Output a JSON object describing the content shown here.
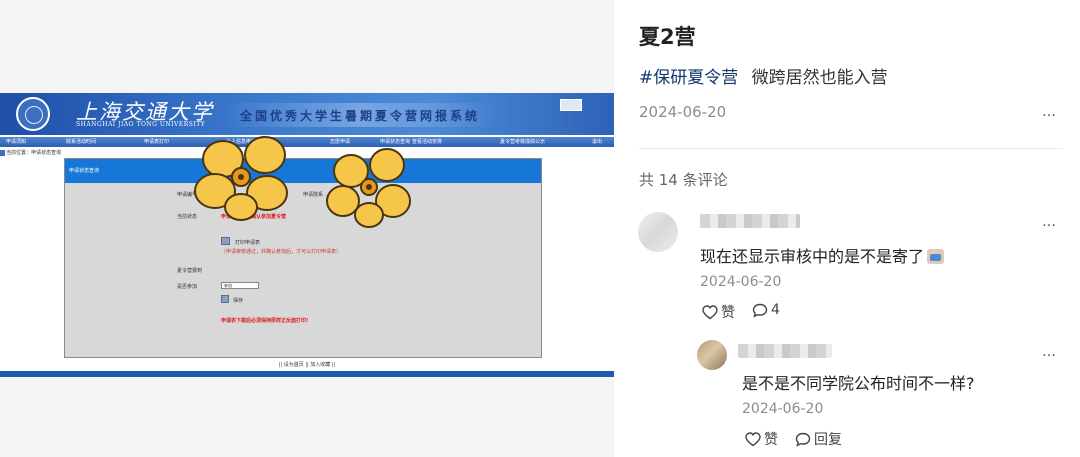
{
  "screenshot": {
    "university_name_cn": "上海交通大学",
    "university_name_en": "SHANGHAI JIAO TONG UNIVERSITY",
    "system_title": "全国优秀大学生暑期夏令营网报系统",
    "nav_items": [
      "申请须知",
      "院系活动时间",
      "申请表打印",
      "个人信息维护",
      "志愿申请",
      "申请状态查询",
      "查看活动安排",
      "夏令营考核成绩公示",
      "退出"
    ],
    "breadcrumb": "当前位置：申请状态查询",
    "status_panel_title": "申请状态查询",
    "apply_label": "申请编号",
    "apply_label_2": "申请院系",
    "status_label": "当前状态",
    "status_value": "申请通过，请确认参加夏令营",
    "print_link": "打印申请表",
    "print_note": "（申请审核通过，并确认参加后，才可以打印申请表）",
    "camp_confirm_heading": "夏令营报到",
    "attend_label": "是否参加",
    "attend_option": "参加",
    "save_label": "保存",
    "warning": "申请表下载后必须保持原样正反面打印!",
    "footer_links": "|| 设为首页 || 加入收藏 ||"
  },
  "post": {
    "title": "夏2营",
    "hashtag": "#保研夏令营",
    "body": "微跨居然也能入营",
    "date": "2024-06-20",
    "more_icon": "…"
  },
  "comments": {
    "count_text": "共 14 条评论",
    "items": [
      {
        "text": "现在还显示审核中的是不是寄了",
        "emoji": "emoji-sticker",
        "date": "2024-06-20",
        "like_label": "赞",
        "reply_count": "4"
      }
    ],
    "reply": {
      "text": "是不是不同学院公布时间不一样?",
      "date": "2024-06-20",
      "like_label": "赞",
      "reply_label": "回复"
    }
  },
  "colors": {
    "hashtag": "#13386c",
    "site_blue": "#1777d8",
    "status_red": "#e0201c"
  }
}
